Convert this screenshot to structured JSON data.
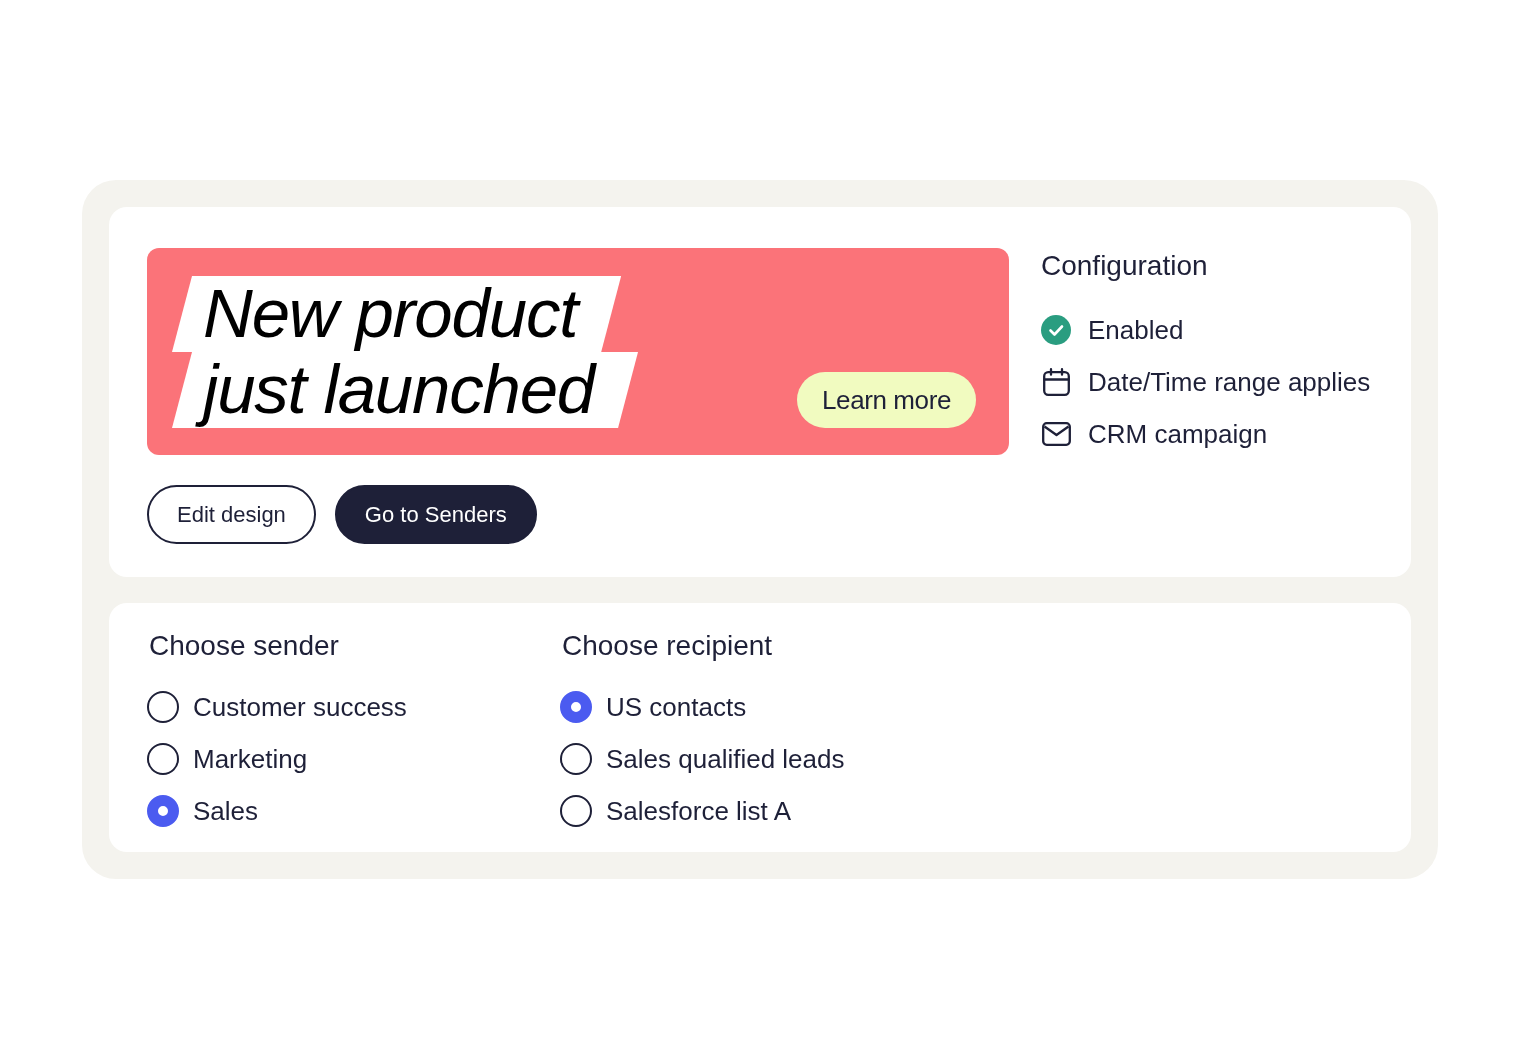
{
  "banner": {
    "headline": [
      "New product",
      "just launched"
    ],
    "button": "Learn more"
  },
  "actions": [
    {
      "label": "Edit design",
      "kind": "outline"
    },
    {
      "label": "Go to Senders",
      "kind": "filled"
    }
  ],
  "configuration": {
    "title": "Configuration",
    "items": [
      {
        "kind": "check",
        "label": "Enabled"
      },
      {
        "kind": "calendar",
        "label": "Date/Time range applies"
      },
      {
        "kind": "mail",
        "label": "CRM campaign"
      }
    ]
  },
  "sender": {
    "title": "Choose sender",
    "options": [
      {
        "label": "Customer success",
        "selected": false
      },
      {
        "label": "Marketing",
        "selected": false
      },
      {
        "label": "Sales",
        "selected": true
      }
    ]
  },
  "recipient": {
    "title": "Choose recipient",
    "options": [
      {
        "label": "US contacts",
        "selected": true
      },
      {
        "label": "Sales qualified leads",
        "selected": false
      },
      {
        "label": "Salesforce list A",
        "selected": false
      }
    ]
  }
}
